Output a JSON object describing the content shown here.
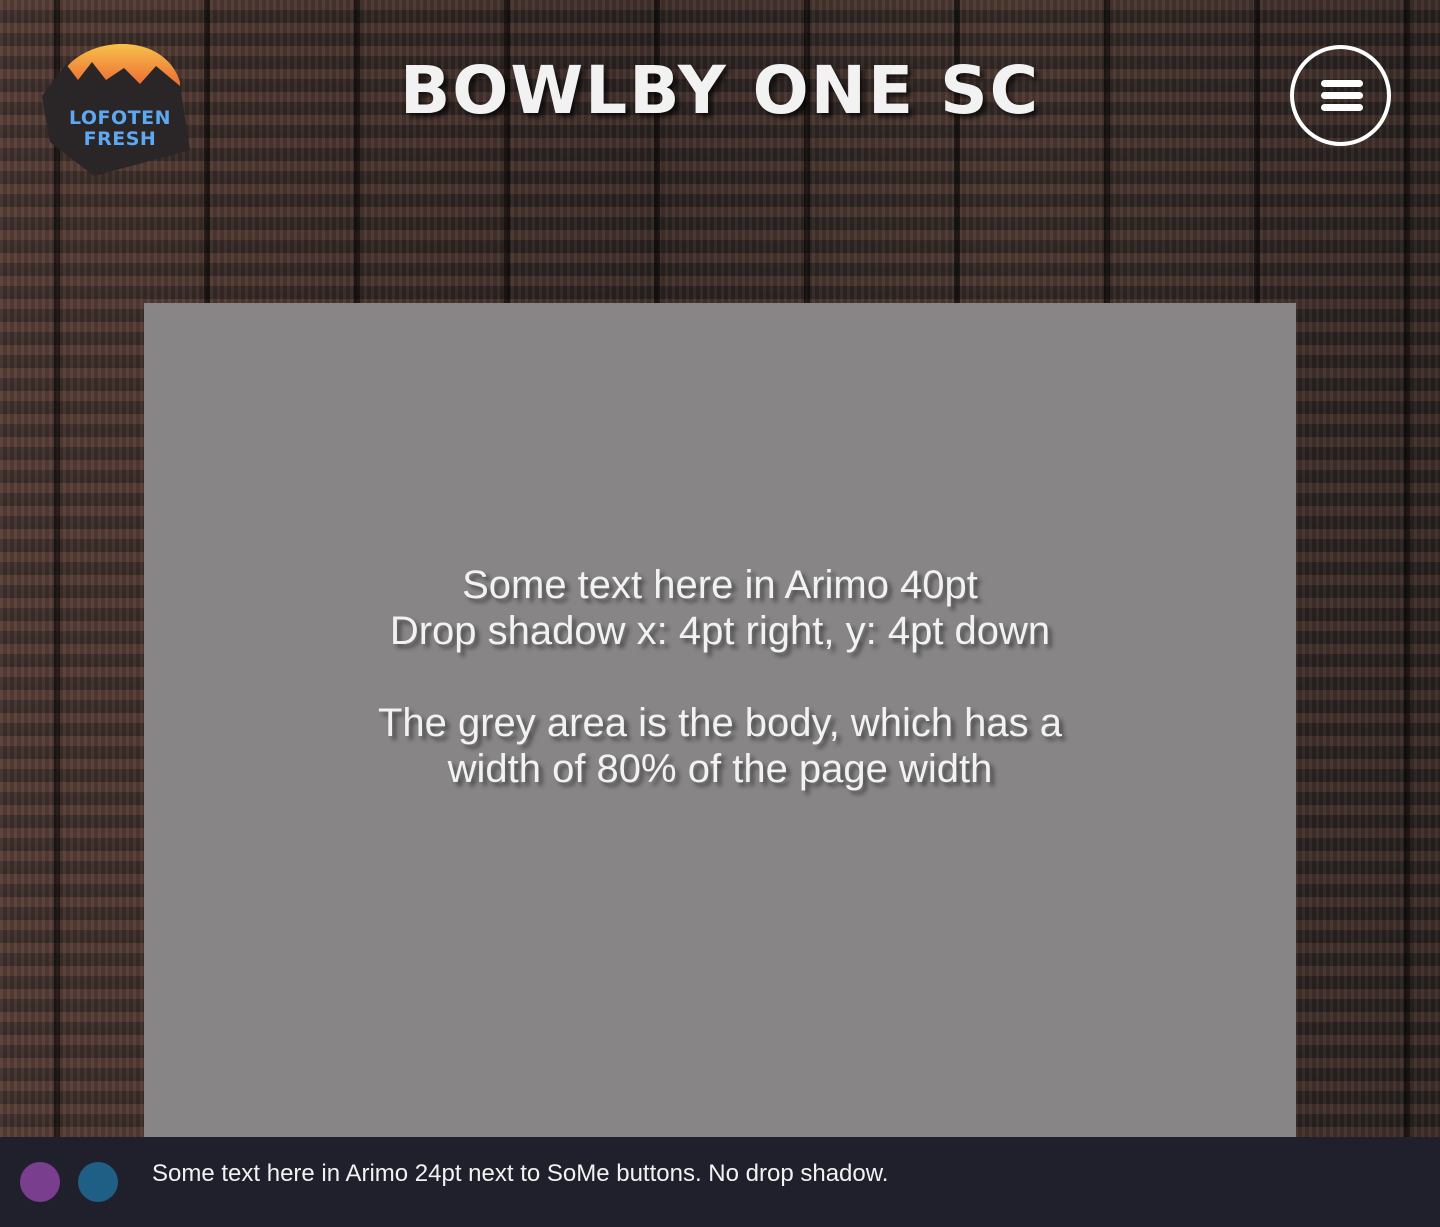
{
  "header": {
    "logo": {
      "line1": "LOFOTEN",
      "line2": "FRESH",
      "colors": {
        "badge": "#2a2526",
        "sun_top": "#f8c14a",
        "sun_bottom": "#e8562e",
        "text": "#5da8f2"
      }
    },
    "title": "BOWLBY ONE SC",
    "menu_icon": "hamburger-menu-icon"
  },
  "main": {
    "background_color": "#878586",
    "text": {
      "line1": "Some text here in Arimo 40pt",
      "line2": "Drop shadow x: 4pt right, y: 4pt down",
      "line3": "The grey area is the body, which has a",
      "line4": "width of 80% of the page width"
    }
  },
  "footer": {
    "background_color": "#20202c",
    "social_buttons": [
      {
        "icon": "social-button-purple",
        "color": "#7a3e8f"
      },
      {
        "icon": "social-button-blue",
        "color": "#1f5f85"
      }
    ],
    "text": "Some text here in Arimo 24pt next to SoMe buttons. No drop shadow."
  }
}
